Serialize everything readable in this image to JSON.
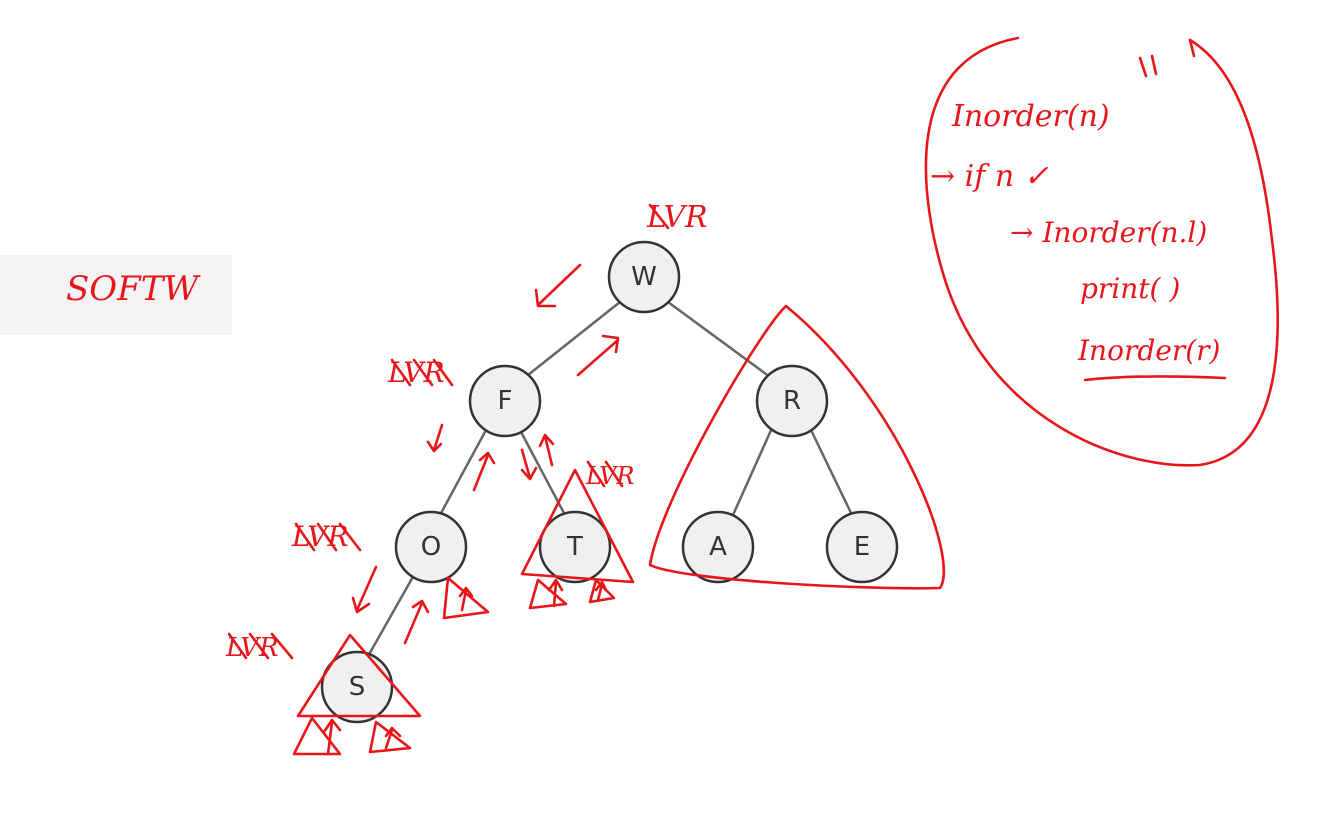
{
  "tree": {
    "nodes": [
      {
        "id": "W",
        "label": "W"
      },
      {
        "id": "F",
        "label": "F"
      },
      {
        "id": "R",
        "label": "R"
      },
      {
        "id": "O",
        "label": "O"
      },
      {
        "id": "T",
        "label": "T"
      },
      {
        "id": "A",
        "label": "A"
      },
      {
        "id": "E",
        "label": "E"
      },
      {
        "id": "S",
        "label": "S"
      }
    ],
    "edges": [
      [
        "W",
        "F"
      ],
      [
        "W",
        "R"
      ],
      [
        "F",
        "O"
      ],
      [
        "F",
        "T"
      ],
      [
        "R",
        "A"
      ],
      [
        "R",
        "E"
      ],
      [
        "O",
        "S"
      ]
    ]
  },
  "annotations": {
    "traversal_output": "SOFTW",
    "traversal_marks": {
      "w": "LVR",
      "f": "LVR",
      "o": "LVR",
      "s": "LVR",
      "t": "LVR"
    },
    "pseudocode": [
      "Inorder(n)",
      "→ if n ✓",
      "→ Inorder(n.l)",
      "print( )",
      "Inorder(r)"
    ]
  },
  "colors": {
    "ink": "#e8161b",
    "node_fill": "#f0f0f0",
    "node_stroke": "#333333",
    "edge": "#666666"
  }
}
